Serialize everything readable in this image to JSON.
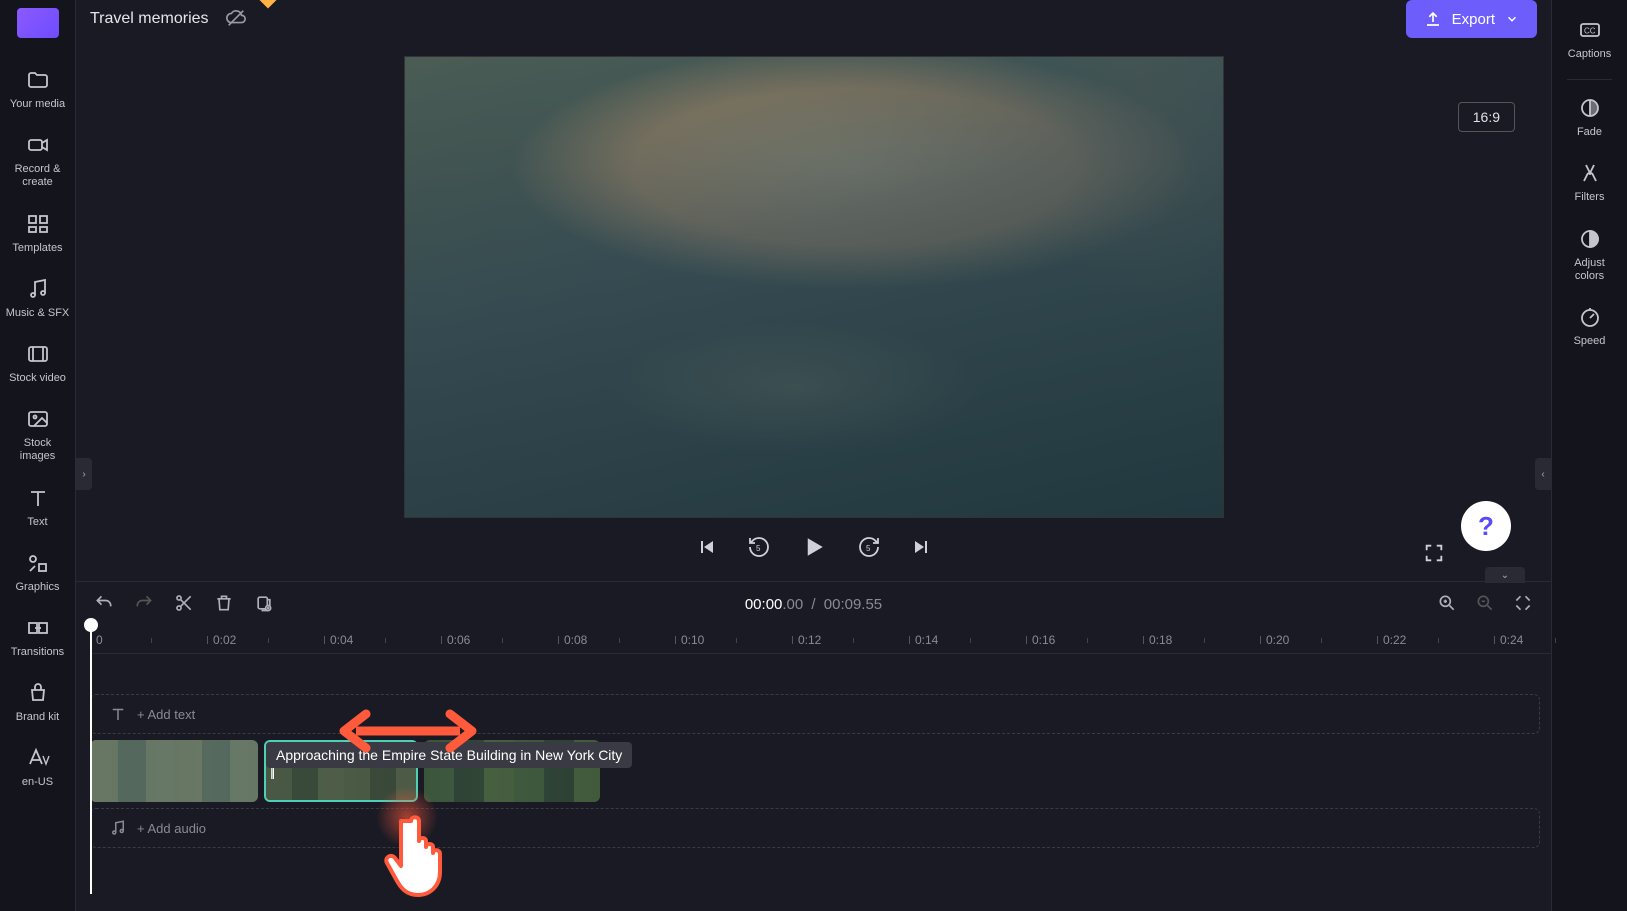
{
  "project_title": "Travel memories",
  "export_label": "Export",
  "aspect_ratio": "16:9",
  "sidebar_left": [
    {
      "key": "your-media",
      "label": "Your media"
    },
    {
      "key": "record-create",
      "label": "Record &\ncreate"
    },
    {
      "key": "templates",
      "label": "Templates"
    },
    {
      "key": "music-sfx",
      "label": "Music & SFX"
    },
    {
      "key": "stock-video",
      "label": "Stock video"
    },
    {
      "key": "stock-images",
      "label": "Stock\nimages"
    },
    {
      "key": "text",
      "label": "Text"
    },
    {
      "key": "graphics",
      "label": "Graphics"
    },
    {
      "key": "transitions",
      "label": "Transitions"
    },
    {
      "key": "brand-kit",
      "label": "Brand kit"
    },
    {
      "key": "language",
      "label": "en-US"
    }
  ],
  "sidebar_right": [
    {
      "key": "captions",
      "label": "Captions"
    },
    {
      "key": "fade",
      "label": "Fade"
    },
    {
      "key": "filters",
      "label": "Filters"
    },
    {
      "key": "adjust-colors",
      "label": "Adjust\ncolors"
    },
    {
      "key": "speed",
      "label": "Speed"
    }
  ],
  "time": {
    "current_main": "00:00",
    "current_ms": ".00",
    "total": "00:09.55"
  },
  "ruler": [
    "0",
    "0:02",
    "0:04",
    "0:06",
    "0:08",
    "0:10",
    "0:12",
    "0:14",
    "0:16",
    "0:18",
    "0:20",
    "0:22",
    "0:24"
  ],
  "add_text_label": "+ Add text",
  "add_audio_label": "+ Add audio",
  "tooltip": "Approaching the Empire State Building in New York City"
}
